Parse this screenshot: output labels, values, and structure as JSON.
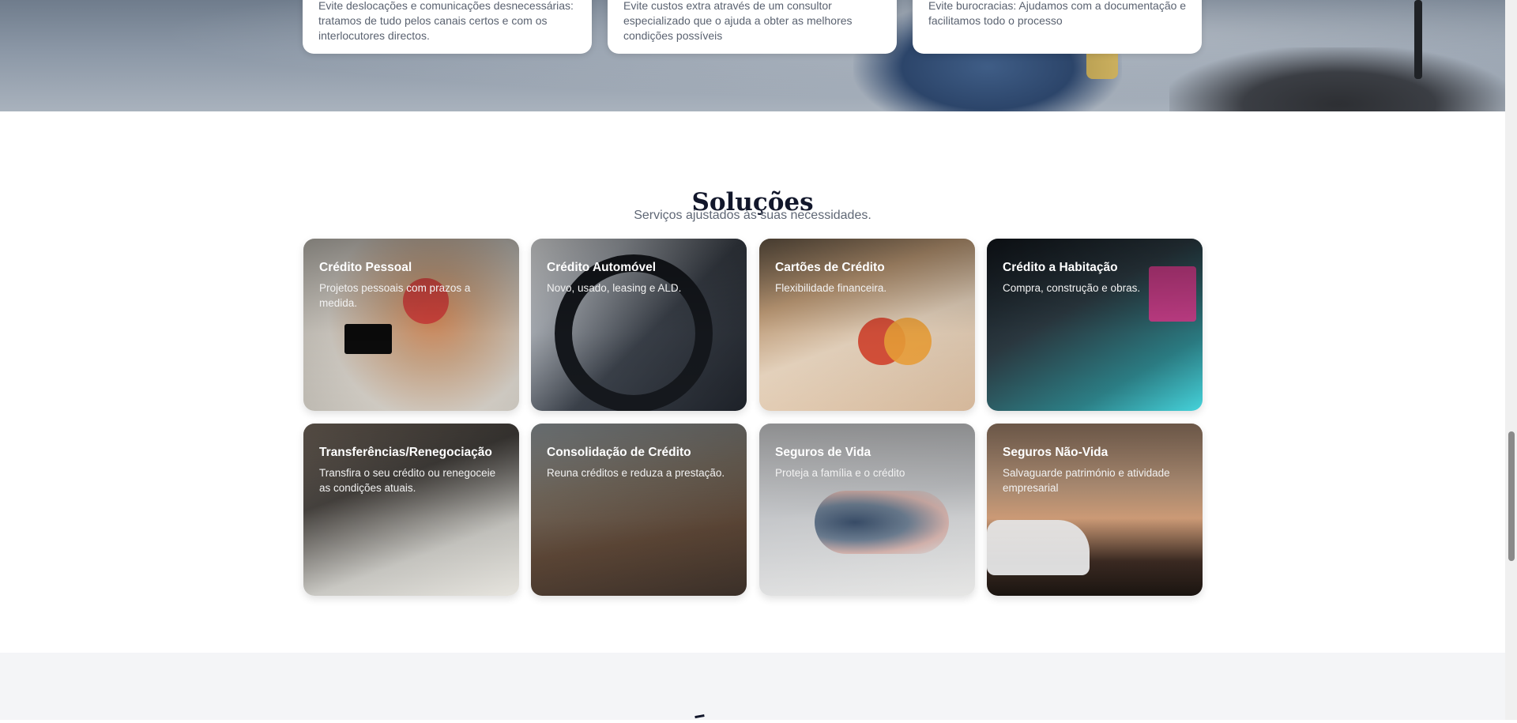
{
  "benefits": [
    {
      "text": "Evite deslocações e comunicações desnecessárias: tratamos de tudo pelos canais certos e com os interlocutores directos."
    },
    {
      "text": "Evite custos extra através de um consultor especializado que o ajuda a obter as melhores condições possíveis"
    },
    {
      "text": "Evite burocracias: Ajudamos com a documentação e facilitamos todo o processo"
    }
  ],
  "solutions": {
    "title": "Soluções",
    "subtitle": "Serviços ajustados às suas necessidades.",
    "items": [
      {
        "title": "Crédito Pessoal",
        "description": "Projetos pessoais com prazos a medida."
      },
      {
        "title": "Crédito Automóvel",
        "description": "Novo, usado, leasing e ALD."
      },
      {
        "title": "Cartões de Crédito",
        "description": "Flexibilidade financeira."
      },
      {
        "title": "Crédito a Habitação",
        "description": "Compra, construção e obras."
      },
      {
        "title": "Transferências/Renegociação",
        "description": "Transfira o seu crédito ou renegoceie as condições atuais."
      },
      {
        "title": "Consolidação de Crédito",
        "description": "Reuna créditos e reduza a prestação."
      },
      {
        "title": "Seguros de Vida",
        "description": "Proteja a família e o crédito"
      },
      {
        "title": "Seguros Não-Vida",
        "description": "Salvaguarde património e atividade empresarial"
      }
    ]
  },
  "colors": {
    "heading": "#12172b",
    "muted_text": "#5f6775",
    "section_bg": "#f4f5f7"
  }
}
